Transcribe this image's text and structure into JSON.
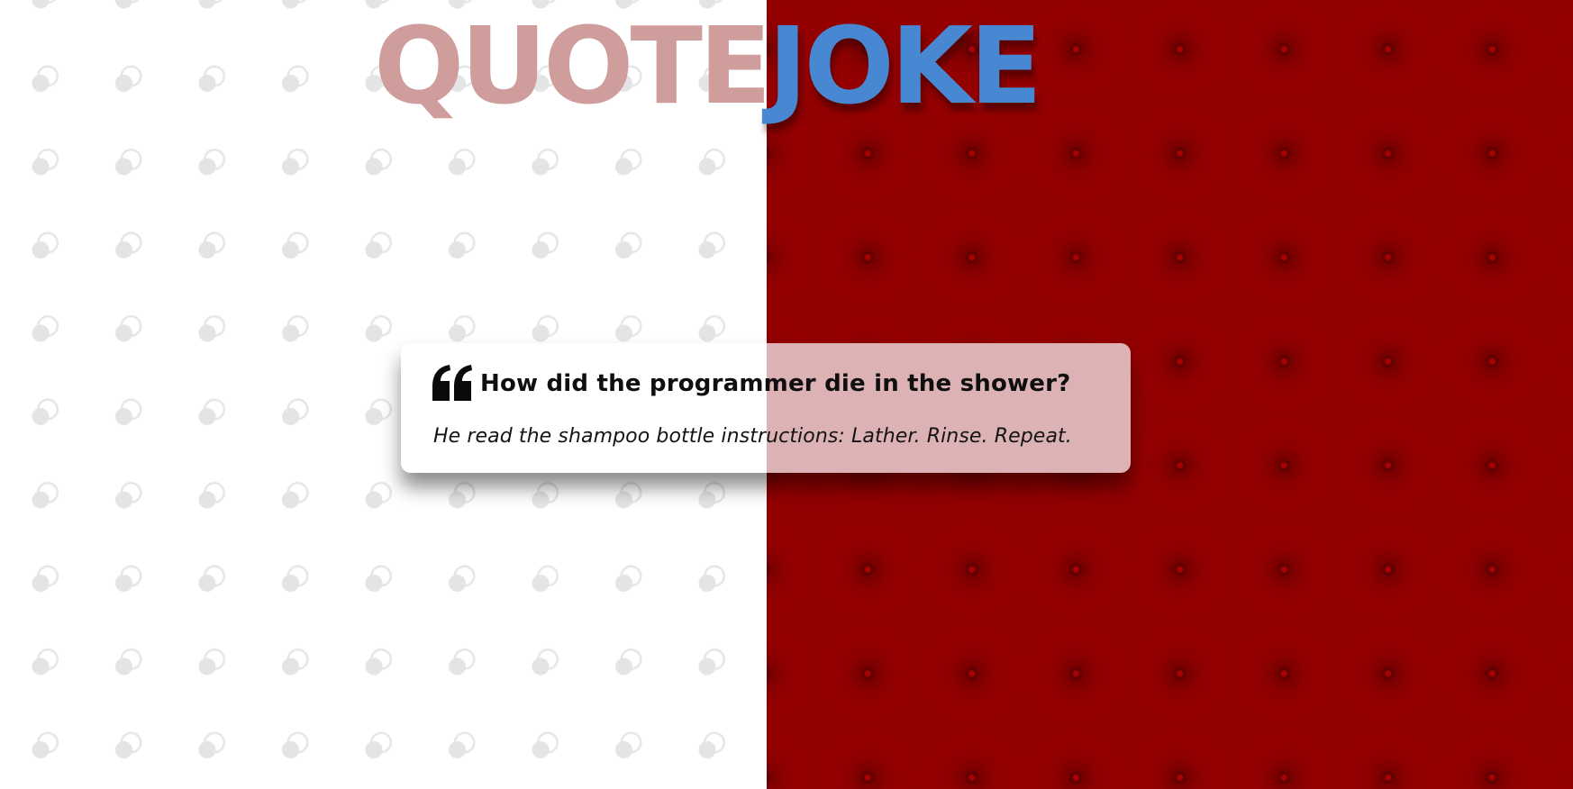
{
  "logo": {
    "part1": "QUOTE",
    "part2": "JOKE",
    "part1_color": "#d09d9d",
    "part2_color": "#4887d2"
  },
  "background": {
    "left_color": "#ffffff",
    "right_color": "#920000"
  },
  "card": {
    "icon": "quote-left-icon",
    "question": "How did the programmer die in the shower?",
    "answer": "He read the shampoo bottle instructions: Lather. Rinse. Repeat."
  }
}
